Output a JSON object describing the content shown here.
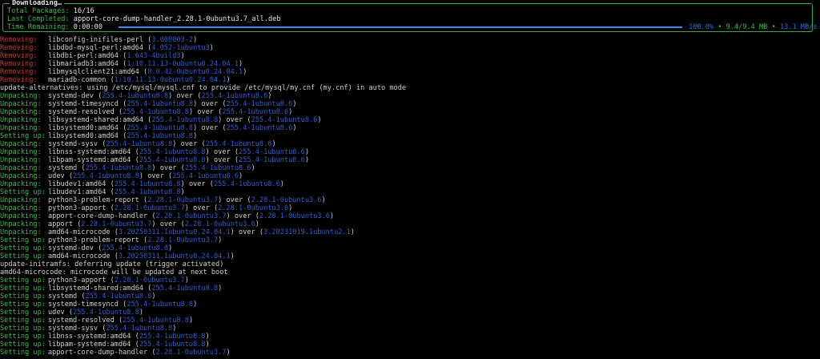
{
  "panel": {
    "title": "Downloading…",
    "total_packages_label": "Total Packages:",
    "total_packages_value": "16/16",
    "last_completed_label": "Last Completed:",
    "last_completed_value": "apport-core-dump-handler_2.28.1-0ubuntu3.7_all.deb",
    "time_remaining_label": "Time Remaining:",
    "time_remaining_value": "0:00:00",
    "progress_fraction": 1.0,
    "percent": "100.0%",
    "size": "9.4/9.4 MB",
    "speed": "13.1 MB/s",
    "separator": "•"
  },
  "colors": {
    "removing": "#c83c3c",
    "unpacking": "#3fb950",
    "version": "#2f5fd0",
    "border": "#3fa34d",
    "progress": "#3b8eea"
  },
  "log": [
    {
      "tag": "Removing:",
      "text": "libconfig-inifiles-perl (",
      "ver": "3.000003-2",
      "after": ")"
    },
    {
      "tag": "Removing:",
      "text": "libdbd-mysql-perl:amd64 (",
      "ver": "4.052-1ubuntu3",
      "after": ")"
    },
    {
      "tag": "Removing:",
      "text": "libdbi-perl:amd64 (",
      "ver": "1.643-4build3",
      "after": ")"
    },
    {
      "tag": "Removing:",
      "text": "libmariadb3:amd64 (",
      "ver": "1:10.11.13-0ubuntu0.24.04.1",
      "after": ")"
    },
    {
      "tag": "Removing:",
      "text": "libmysqlclient21:amd64 (",
      "ver": "8.0.42-0ubuntu0.24.04.1",
      "after": ")"
    },
    {
      "tag": "Removing:",
      "text": "mariadb-common (",
      "ver": "1:10.11.13-0ubuntu0.24.04.1",
      "after": ")"
    },
    {
      "tag": "",
      "text": "update-alternatives: using /etc/mysql/mysql.cnf to provide /etc/mysql/my.cnf (my.cnf) in auto mode",
      "ver": "",
      "after": ""
    },
    {
      "tag": "Unpacking:",
      "text": "systemd-dev (",
      "ver": "255.4-1ubuntu8.8",
      "after": ") over (",
      "ver2": "255.4-1ubuntu8.6",
      "after2": ")"
    },
    {
      "tag": "Unpacking:",
      "text": "systemd-timesyncd (",
      "ver": "255.4-1ubuntu8.8",
      "after": ") over (",
      "ver2": "255.4-1ubuntu8.6",
      "after2": ")"
    },
    {
      "tag": "Unpacking:",
      "text": "systemd-resolved (",
      "ver": "255.4-1ubuntu8.8",
      "after": ") over (",
      "ver2": "255.4-1ubuntu8.6",
      "after2": ")"
    },
    {
      "tag": "Unpacking:",
      "text": "libsystemd-shared:amd64 (",
      "ver": "255.4-1ubuntu8.8",
      "after": ") over (",
      "ver2": "255.4-1ubuntu8.6",
      "after2": ")"
    },
    {
      "tag": "Unpacking:",
      "text": "libsystemd0:amd64 (",
      "ver": "255.4-1ubuntu8.8",
      "after": ") over (",
      "ver2": "255.4-1ubuntu8.6",
      "after2": ")"
    },
    {
      "tag": "Setting up:",
      "text": "libsystemd0:amd64 (",
      "ver": "255.4-1ubuntu8.8",
      "after": ")"
    },
    {
      "tag": "Unpacking:",
      "text": "systemd-sysv (",
      "ver": "255.4-1ubuntu8.8",
      "after": ") over (",
      "ver2": "255.4-1ubuntu8.6",
      "after2": ")"
    },
    {
      "tag": "Unpacking:",
      "text": "libnss-systemd:amd64 (",
      "ver": "255.4-1ubuntu8.8",
      "after": ") over (",
      "ver2": "255.4-1ubuntu8.6",
      "after2": ")"
    },
    {
      "tag": "Unpacking:",
      "text": "libpam-systemd:amd64 (",
      "ver": "255.4-1ubuntu8.8",
      "after": ") over (",
      "ver2": "255.4-1ubuntu8.6",
      "after2": ")"
    },
    {
      "tag": "Unpacking:",
      "text": "systemd (",
      "ver": "255.4-1ubuntu8.8",
      "after": ") over (",
      "ver2": "255.4-1ubuntu8.6",
      "after2": ")"
    },
    {
      "tag": "Unpacking:",
      "text": "udev (",
      "ver": "255.4-1ubuntu8.8",
      "after": ") over (",
      "ver2": "255.4-1ubuntu8.6",
      "after2": ")"
    },
    {
      "tag": "Unpacking:",
      "text": "libudev1:amd64 (",
      "ver": "255.4-1ubuntu8.8",
      "after": ") over (",
      "ver2": "255.4-1ubuntu8.6",
      "after2": ")"
    },
    {
      "tag": "Setting up:",
      "text": "libudev1:amd64 (",
      "ver": "255.4-1ubuntu8.8",
      "after": ")"
    },
    {
      "tag": "Unpacking:",
      "text": "python3-problem-report (",
      "ver": "2.28.1-0ubuntu3.7",
      "after": ") over (",
      "ver2": "2.28.1-0ubuntu3.6",
      "after2": ")"
    },
    {
      "tag": "Unpacking:",
      "text": "python3-apport (",
      "ver": "2.28.1-0ubuntu3.7",
      "after": ") over (",
      "ver2": "2.28.1-0ubuntu3.6",
      "after2": ")"
    },
    {
      "tag": "Unpacking:",
      "text": "apport-core-dump-handler (",
      "ver": "2.28.1-0ubuntu3.7",
      "after": ") over (",
      "ver2": "2.28.1-0ubuntu3.6",
      "after2": ")"
    },
    {
      "tag": "Unpacking:",
      "text": "apport (",
      "ver": "2.28.1-0ubuntu3.7",
      "after": ") over (",
      "ver2": "2.28.1-0ubuntu3.6",
      "after2": ")"
    },
    {
      "tag": "Unpacking:",
      "text": "amd64-microcode (",
      "ver": "3.20250311.1ubuntu0.24.04.1",
      "after": ") over (",
      "ver2": "3.20231019.1ubuntu2.1",
      "after2": ")"
    },
    {
      "tag": "Setting up:",
      "text": "python3-problem-report (",
      "ver": "2.28.1-0ubuntu3.7",
      "after": ")"
    },
    {
      "tag": "Setting up:",
      "text": "systemd-dev (",
      "ver": "255.4-1ubuntu8.8",
      "after": ")"
    },
    {
      "tag": "Setting up:",
      "text": "amd64-microcode (",
      "ver": "3.20250311.1ubuntu0.24.04.1",
      "after": ")"
    },
    {
      "tag": "",
      "text": "update-initramfs: deferring update (trigger activated)",
      "ver": "",
      "after": ""
    },
    {
      "tag": "",
      "text": "amd64-microcode: microcode will be updated at next boot",
      "ver": "",
      "after": ""
    },
    {
      "tag": "Setting up:",
      "text": "python3-apport (",
      "ver": "2.28.1-0ubuntu3.7",
      "after": ")"
    },
    {
      "tag": "Setting up:",
      "text": "libsystemd-shared:amd64 (",
      "ver": "255.4-1ubuntu8.8",
      "after": ")"
    },
    {
      "tag": "Setting up:",
      "text": "systemd (",
      "ver": "255.4-1ubuntu8.8",
      "after": ")"
    },
    {
      "tag": "Setting up:",
      "text": "systemd-timesyncd (",
      "ver": "255.4-1ubuntu8.8",
      "after": ")"
    },
    {
      "tag": "Setting up:",
      "text": "udev (",
      "ver": "255.4-1ubuntu8.8",
      "after": ")"
    },
    {
      "tag": "Setting up:",
      "text": "systemd-resolved (",
      "ver": "255.4-1ubuntu8.8",
      "after": ")"
    },
    {
      "tag": "Setting up:",
      "text": "systemd-sysv (",
      "ver": "255.4-1ubuntu8.8",
      "after": ")"
    },
    {
      "tag": "Setting up:",
      "text": "libnss-systemd:amd64 (",
      "ver": "255.4-1ubuntu8.8",
      "after": ")"
    },
    {
      "tag": "Setting up:",
      "text": "libpam-systemd:amd64 (",
      "ver": "255.4-1ubuntu8.8",
      "after": ")"
    },
    {
      "tag": "Setting up:",
      "text": "apport-core-dump-handler (",
      "ver": "2.28.1-0ubuntu3.7",
      "after": ")"
    }
  ]
}
